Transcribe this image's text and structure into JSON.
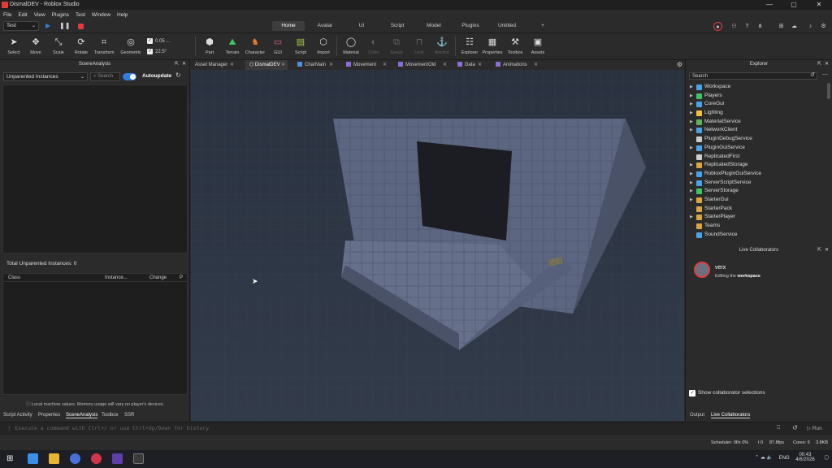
{
  "window": {
    "title": "DismalDEV - Roblox Studio",
    "minimize": "—",
    "maximize": "▢",
    "close": "✕"
  },
  "menu": [
    "File",
    "Edit",
    "View",
    "Plugins",
    "Test",
    "Window",
    "Help"
  ],
  "ribbon": {
    "mode_select": "Test",
    "tabs": [
      "Home",
      "Avatar",
      "UI",
      "Script",
      "Model",
      "Plugins",
      "Untitled"
    ],
    "active_tab": "Home",
    "add_tab": "+"
  },
  "toolbar": {
    "tools": [
      "Select",
      "Move",
      "Scale",
      "Rotate",
      "Transform",
      "Geometric"
    ],
    "move_snap": "0.05 ...",
    "rotate_snap": "22.5°",
    "insert": [
      "Part",
      "Terrain",
      "Character",
      "GUI",
      "Script",
      "Import"
    ],
    "edit": [
      "Material",
      "Color",
      "Group",
      "Lock",
      "Anchor"
    ],
    "windows": [
      "Explorer",
      "Properties",
      "Toolbox",
      "Assets"
    ]
  },
  "doc_tabs": [
    "Asset Manager",
    "DismalDEV",
    "CharMain",
    "Movement",
    "MovementOld",
    "Data",
    "Animations"
  ],
  "active_doc_tab": "DismalDEV",
  "scene_analysis": {
    "title": "SceneAnalysis",
    "dropdown_value": "Unparented Instances",
    "search_placeholder": "Search",
    "autoupdate_label": "Autoupdate",
    "autoupdate_on": true,
    "total_label": "Total Unparented Instances: 0",
    "columns": [
      "Class",
      "Instance...",
      "Change",
      "P"
    ],
    "note": "Local machine values. Memory usage will vary on player's devices.",
    "bottom_tabs": [
      "Script Activity",
      "Properties",
      "SceneAnalysis",
      "Toolbox",
      "SSR"
    ],
    "active_bottom_tab": "SceneAnalysis"
  },
  "explorer": {
    "title": "Explorer",
    "search_placeholder": "Search",
    "items": [
      {
        "name": "Workspace",
        "icon": "workspace-icon",
        "color": "#4aa3e8",
        "expandable": true
      },
      {
        "name": "Players",
        "icon": "players-icon",
        "color": "#3fc46a",
        "expandable": true
      },
      {
        "name": "CoreGui",
        "icon": "coregui-icon",
        "color": "#4aa3e8",
        "expandable": true
      },
      {
        "name": "Lighting",
        "icon": "lighting-icon",
        "color": "#f2c23a",
        "expandable": true
      },
      {
        "name": "MaterialService",
        "icon": "material-icon",
        "color": "#5fb25c",
        "expandable": true
      },
      {
        "name": "NetworkClient",
        "icon": "network-icon",
        "color": "#4aa3e8",
        "expandable": true
      },
      {
        "name": "PluginDebugService",
        "icon": "debug-icon",
        "color": "#cccccc",
        "expandable": false
      },
      {
        "name": "PluginGuiService",
        "icon": "plugingui-icon",
        "color": "#4aa3e8",
        "expandable": true
      },
      {
        "name": "ReplicatedFirst",
        "icon": "replicated-icon",
        "color": "#cfcfcf",
        "expandable": false
      },
      {
        "name": "ReplicatedStorage",
        "icon": "storage-icon",
        "color": "#d9a441",
        "expandable": true
      },
      {
        "name": "RobloxPluginGuiService",
        "icon": "plugingui-icon",
        "color": "#4aa3e8",
        "expandable": true
      },
      {
        "name": "ServerScriptService",
        "icon": "serverscript-icon",
        "color": "#4aa3e8",
        "expandable": true
      },
      {
        "name": "ServerStorage",
        "icon": "serverstorage-icon",
        "color": "#3fc46a",
        "expandable": true
      },
      {
        "name": "StarterGui",
        "icon": "startergui-icon",
        "color": "#d9a441",
        "expandable": true
      },
      {
        "name": "StarterPack",
        "icon": "starterpack-icon",
        "color": "#d9a441",
        "expandable": false
      },
      {
        "name": "StarterPlayer",
        "icon": "starterplayer-icon",
        "color": "#d9a441",
        "expandable": true
      },
      {
        "name": "Teams",
        "icon": "teams-icon",
        "color": "#d9a441",
        "expandable": false
      },
      {
        "name": "SoundService",
        "icon": "sound-icon",
        "color": "#4aa3e8",
        "expandable": false
      }
    ]
  },
  "live_collab": {
    "title": "Live Collaborators",
    "user": "verx",
    "editing_prefix": "Editing the ",
    "editing_target": "workspace",
    "show_selections_label": "Show collaborator selections",
    "bottom_tabs": [
      "Output",
      "Live Collaborators"
    ],
    "active_bottom_tab": "Live Collaborators"
  },
  "command_bar": {
    "placeholder": "Execute a command with Ctrl+/ or use Ctrl+Up/Down for history",
    "run_label": "Run"
  },
  "status": {
    "scheduler": "Scheduler: 0f/s 0%",
    "t": "t 0",
    "fps": "87.8fps",
    "cores": "Cores: 6",
    "memory": "3.8KB"
  },
  "tray": {
    "lang": "ENG",
    "time": "00:43",
    "date": "4/6/2026"
  },
  "colors": {
    "accent": "#2f7de1",
    "record": "#e03c3c",
    "bg": "#2b2b2b"
  }
}
